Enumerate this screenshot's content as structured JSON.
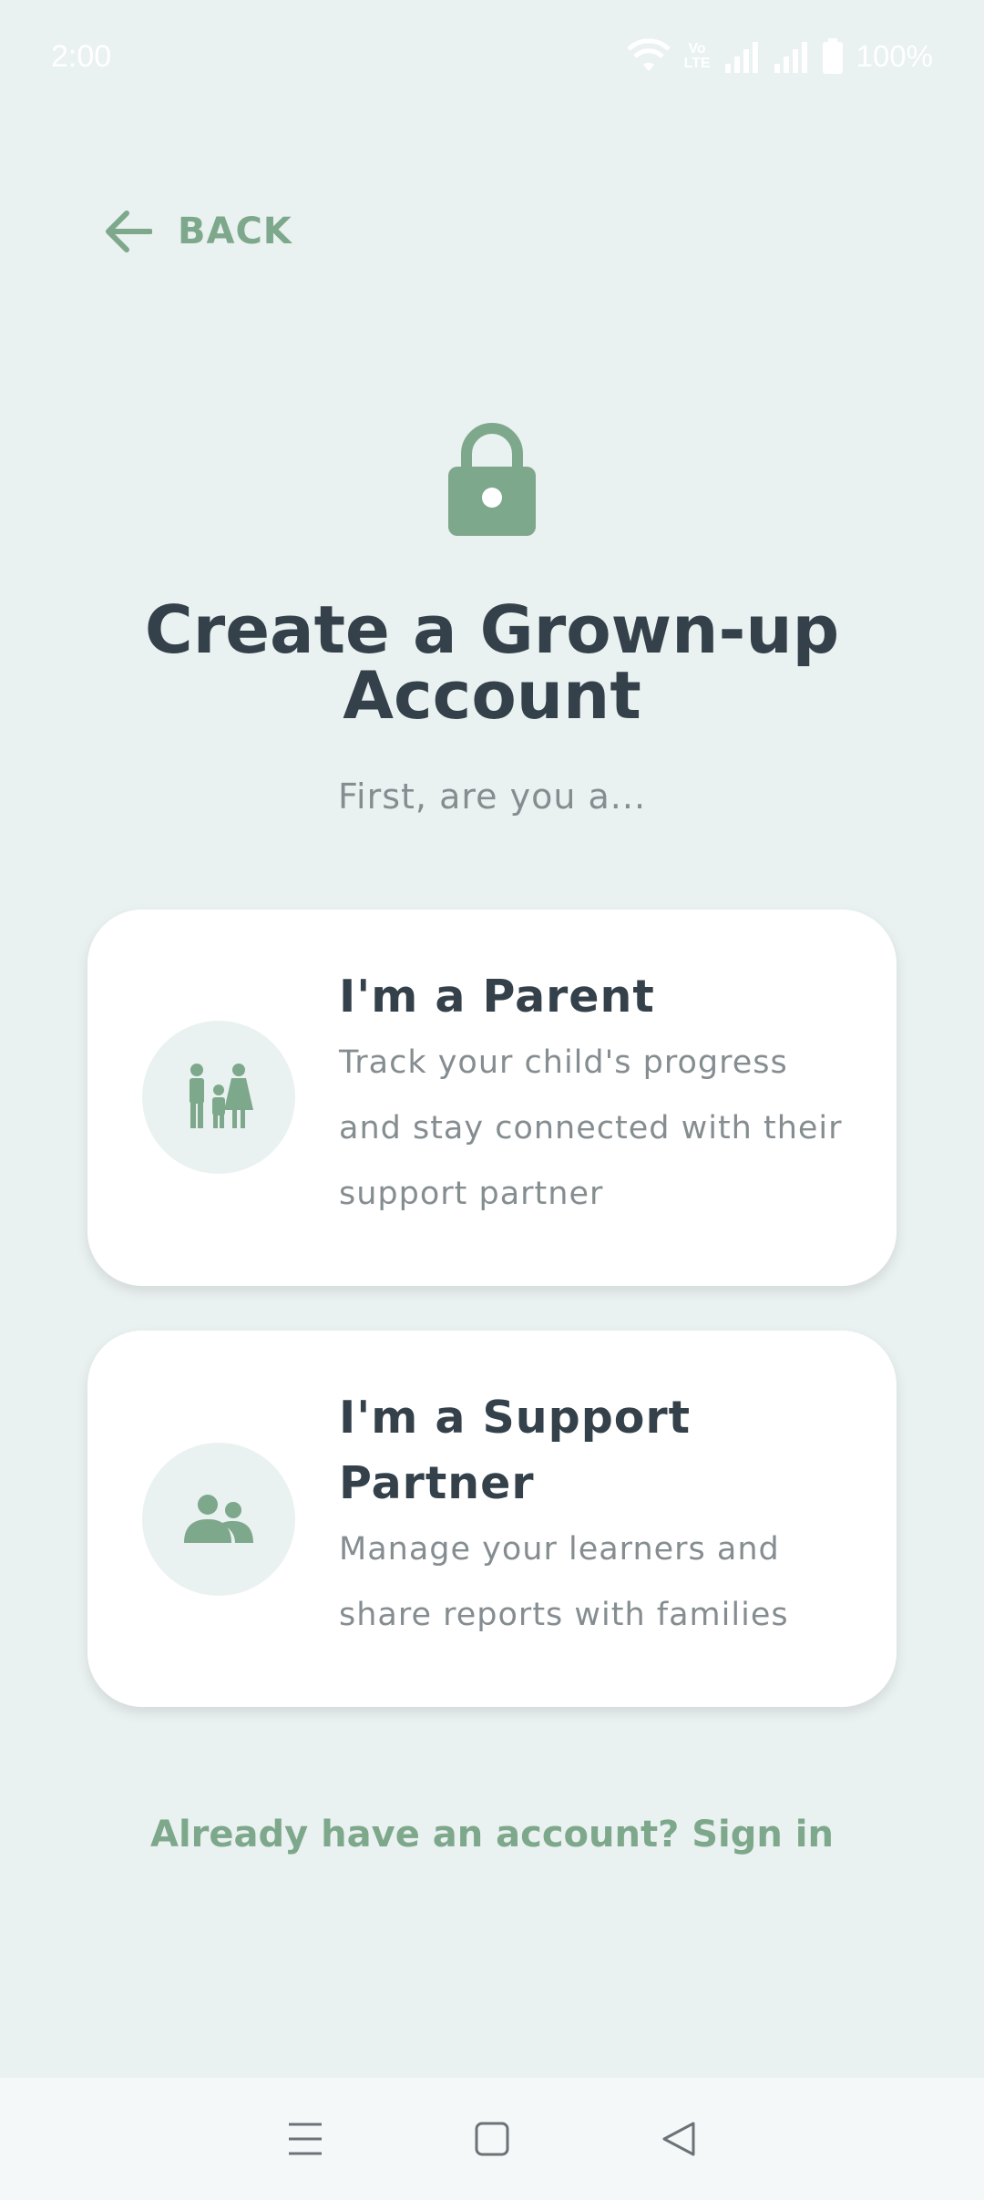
{
  "status_bar": {
    "time": "2:00",
    "volte_top": "Vo",
    "volte_bottom": "LTE",
    "battery": "100%",
    "icons": [
      "wifi-icon",
      "volte-icon",
      "signal-icon",
      "signal-icon",
      "battery-icon"
    ]
  },
  "header": {
    "back_label": "BACK",
    "back_icon": "arrow-left-icon"
  },
  "hero": {
    "icon": "lock-icon",
    "title_line1": "Create a Grown-up",
    "title_line2": "Account",
    "subtitle": "First, are you a..."
  },
  "options": [
    {
      "icon": "family-icon",
      "title": "I'm a Parent",
      "description": "Track your child's progress and stay connected with their support partner"
    },
    {
      "icon": "people-icon",
      "title": "I'm a Support Partner",
      "description": "Manage your learners and share reports with families"
    }
  ],
  "footer": {
    "signin_text": "Already have an account? Sign in"
  },
  "nav_bar": {
    "icons": [
      "menu-icon",
      "home-icon",
      "back-triangle-icon"
    ]
  },
  "colors": {
    "background": "#eaf1f1",
    "accent": "#7ea88b",
    "title": "#34414a",
    "muted": "#858d91",
    "card": "#ffffff"
  }
}
